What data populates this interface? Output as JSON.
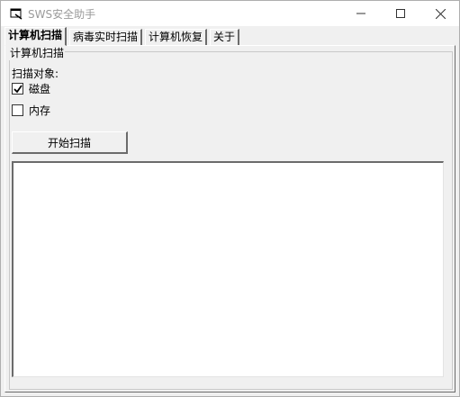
{
  "window": {
    "title": "SWS安全助手",
    "app_icon": "app-icon",
    "controls": [
      "minimize-icon",
      "maximize-icon",
      "close-icon"
    ]
  },
  "tabs": [
    {
      "label": "计算机扫描",
      "active": true
    },
    {
      "label": "病毒实时扫描",
      "active": false
    },
    {
      "label": "计算机恢复",
      "active": false
    },
    {
      "label": "关于",
      "active": false
    }
  ],
  "scan_panel": {
    "group_title": "计算机扫描",
    "target_label": "扫描对象:",
    "options": [
      {
        "label": "磁盘",
        "checked": true
      },
      {
        "label": "内存",
        "checked": false
      }
    ],
    "start_button": "开始扫描",
    "results_text": ""
  }
}
